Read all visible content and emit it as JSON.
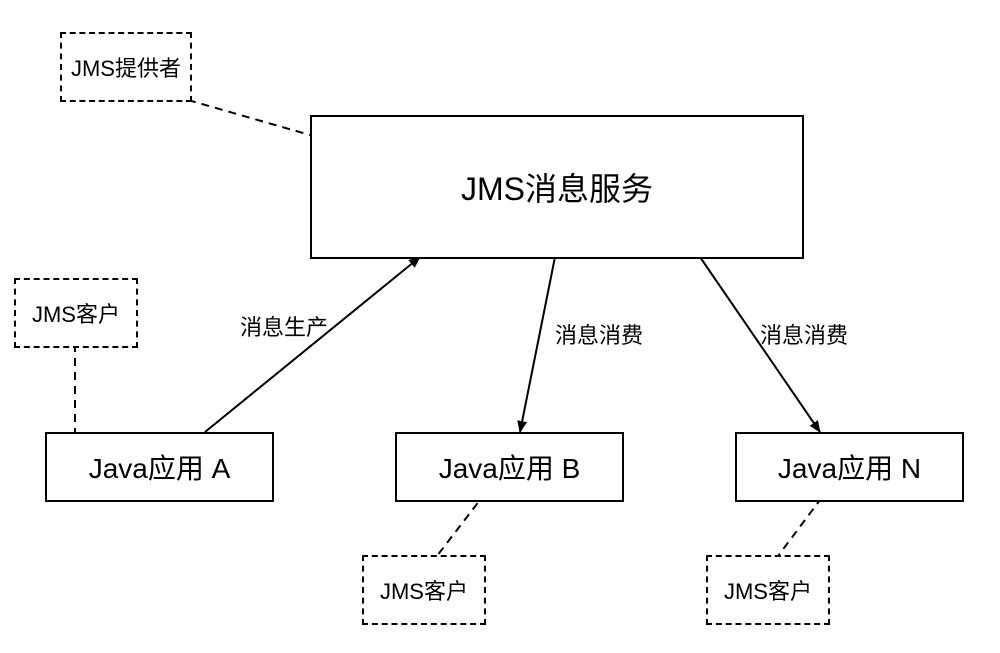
{
  "boxes": {
    "service": "JMS消息服务",
    "appA": "Java应用 A",
    "appB": "Java应用 B",
    "appN": "Java应用 N"
  },
  "notes": {
    "provider": "JMS提供者",
    "clientA": "JMS客户",
    "clientB": "JMS客户",
    "clientN": "JMS客户"
  },
  "edges": {
    "produce": "消息生产",
    "consumeB": "消息消费",
    "consumeN": "消息消费"
  }
}
